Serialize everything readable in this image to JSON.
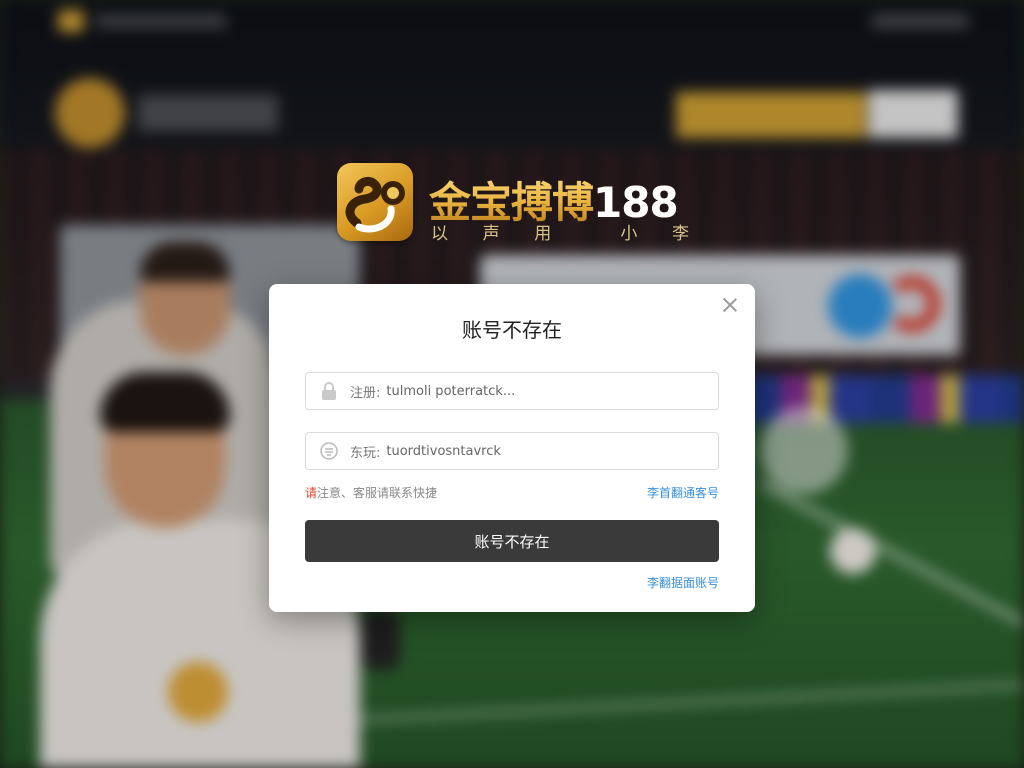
{
  "brand": {
    "title": "金宝搏博",
    "title_number": "188",
    "slogan": [
      "以",
      "声",
      "用",
      "",
      "小",
      "李"
    ]
  },
  "dialog": {
    "title": "账号不存在",
    "username": {
      "label": "注册:",
      "value": "tulmoli poterratck..."
    },
    "password": {
      "label": "东玩:",
      "value": "tuordtivosntavrck"
    },
    "notice_mark": "请",
    "notice_text": "注意、客服请联系快捷",
    "link_right": "李首翻通客号",
    "submit_label": "账号不存在",
    "link_bottom": "李翻据面账号"
  },
  "colors": {
    "accent_gold": "#e8b23c",
    "button_dark": "#3a3a3a",
    "link_blue": "#3a8fd8",
    "notice_red": "#e0442c"
  },
  "icons": {
    "close": "close-icon",
    "username": "lock-icon",
    "password": "shield-icon",
    "brand": "dragon-logo-icon"
  }
}
